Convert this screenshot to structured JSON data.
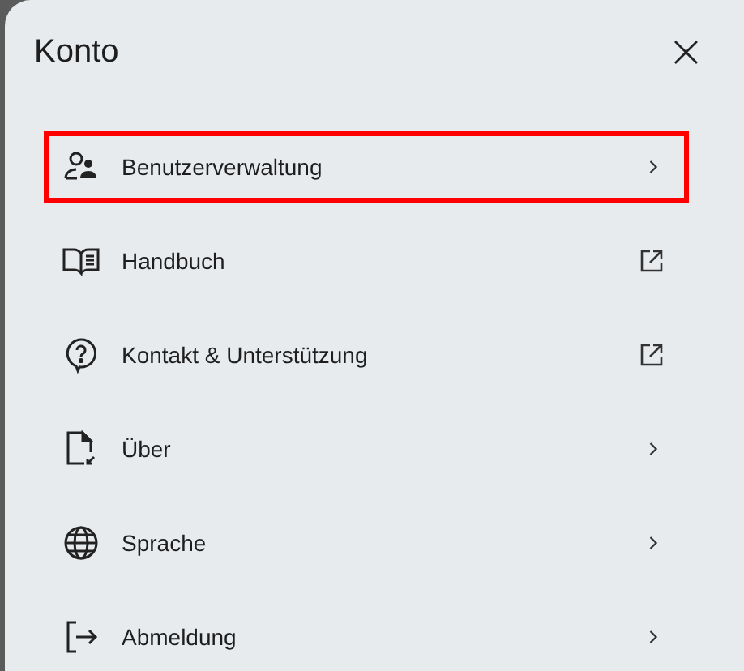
{
  "panel": {
    "title": "Konto",
    "close": "×"
  },
  "items": [
    {
      "label": "Benutzerverwaltung",
      "kind": "submenu",
      "highlighted": true
    },
    {
      "label": "Handbuch",
      "kind": "external",
      "highlighted": false
    },
    {
      "label": "Kontakt & Unterstützung",
      "kind": "external",
      "highlighted": false
    },
    {
      "label": "Über",
      "kind": "submenu",
      "highlighted": false
    },
    {
      "label": "Sprache",
      "kind": "submenu",
      "highlighted": false
    },
    {
      "label": "Abmeldung",
      "kind": "submenu",
      "highlighted": false
    }
  ]
}
